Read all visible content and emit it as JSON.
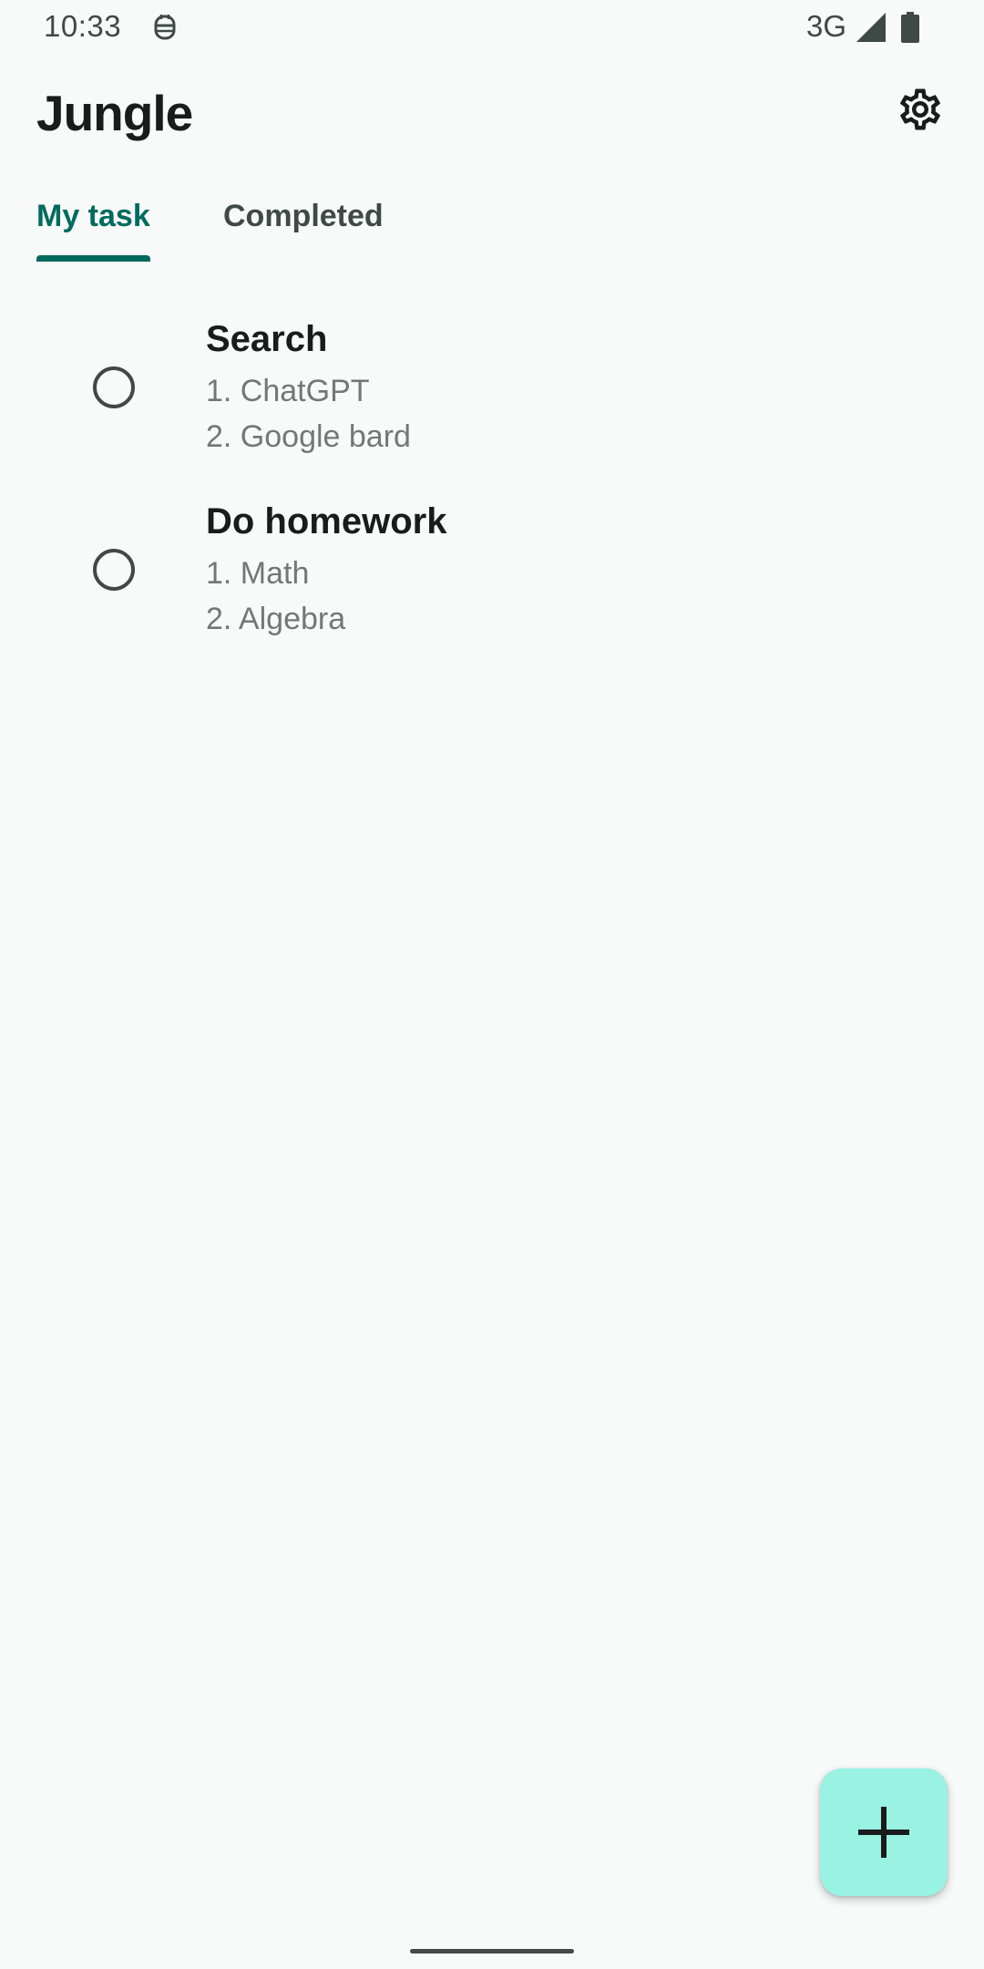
{
  "status_bar": {
    "time": "10:33",
    "network": "3G",
    "app_icon": "notification-app-icon",
    "signal_icon": "signal-icon",
    "battery_icon": "battery-icon"
  },
  "app_bar": {
    "title": "Jungle",
    "settings_icon": "gear-icon"
  },
  "tabs": [
    {
      "label": "My task",
      "selected": true
    },
    {
      "label": "Completed",
      "selected": false
    }
  ],
  "tasks": [
    {
      "title": "Search",
      "lines": [
        "1. ChatGPT",
        "2. Google bard"
      ],
      "completed": false
    },
    {
      "title": "Do homework",
      "lines": [
        "1. Math",
        "2. Algebra"
      ],
      "completed": false
    }
  ],
  "fab": {
    "icon": "plus-icon"
  },
  "colors": {
    "background": "#f8faf9",
    "accent": "#006b5e",
    "fab_background": "#99f2e2",
    "text_primary": "#191c1b",
    "text_secondary": "#6f7976"
  }
}
